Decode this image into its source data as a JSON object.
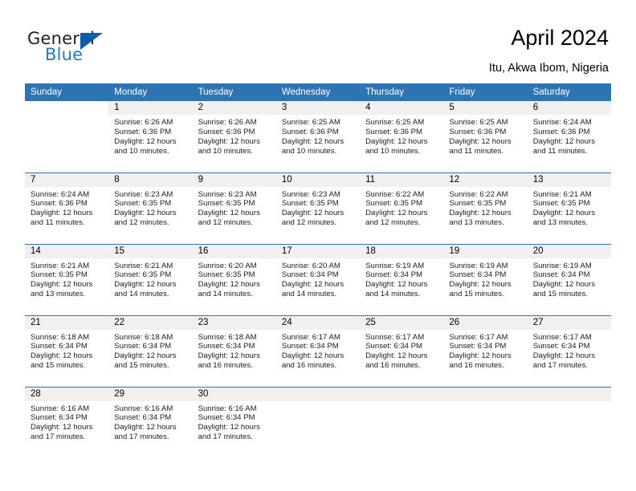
{
  "brand": {
    "name_part1": "General",
    "name_part2": "Blue",
    "triangle_icon": "triangle-icon"
  },
  "header": {
    "title": "April 2024",
    "location": "Itu, Akwa Ibom, Nigeria"
  },
  "colors": {
    "header_blue": "#2d74b5",
    "daynum_band": "#f0f0f0",
    "brand_blue": "#1f7ac4",
    "triangle_blue": "#0b5ea8"
  },
  "calendar": {
    "weekday_headers": [
      "Sunday",
      "Monday",
      "Tuesday",
      "Wednesday",
      "Thursday",
      "Friday",
      "Saturday"
    ],
    "weeks": [
      [
        {
          "day": "",
          "blank": true,
          "sunrise": "",
          "sunset": "",
          "daylight1": "",
          "daylight2": ""
        },
        {
          "day": "1",
          "sunrise": "Sunrise: 6:26 AM",
          "sunset": "Sunset: 6:36 PM",
          "daylight1": "Daylight: 12 hours",
          "daylight2": "and 10 minutes."
        },
        {
          "day": "2",
          "sunrise": "Sunrise: 6:26 AM",
          "sunset": "Sunset: 6:36 PM",
          "daylight1": "Daylight: 12 hours",
          "daylight2": "and 10 minutes."
        },
        {
          "day": "3",
          "sunrise": "Sunrise: 6:25 AM",
          "sunset": "Sunset: 6:36 PM",
          "daylight1": "Daylight: 12 hours",
          "daylight2": "and 10 minutes."
        },
        {
          "day": "4",
          "sunrise": "Sunrise: 6:25 AM",
          "sunset": "Sunset: 6:36 PM",
          "daylight1": "Daylight: 12 hours",
          "daylight2": "and 10 minutes."
        },
        {
          "day": "5",
          "sunrise": "Sunrise: 6:25 AM",
          "sunset": "Sunset: 6:36 PM",
          "daylight1": "Daylight: 12 hours",
          "daylight2": "and 11 minutes."
        },
        {
          "day": "6",
          "sunrise": "Sunrise: 6:24 AM",
          "sunset": "Sunset: 6:36 PM",
          "daylight1": "Daylight: 12 hours",
          "daylight2": "and 11 minutes."
        }
      ],
      [
        {
          "day": "7",
          "sunrise": "Sunrise: 6:24 AM",
          "sunset": "Sunset: 6:36 PM",
          "daylight1": "Daylight: 12 hours",
          "daylight2": "and 11 minutes."
        },
        {
          "day": "8",
          "sunrise": "Sunrise: 6:23 AM",
          "sunset": "Sunset: 6:35 PM",
          "daylight1": "Daylight: 12 hours",
          "daylight2": "and 12 minutes."
        },
        {
          "day": "9",
          "sunrise": "Sunrise: 6:23 AM",
          "sunset": "Sunset: 6:35 PM",
          "daylight1": "Daylight: 12 hours",
          "daylight2": "and 12 minutes."
        },
        {
          "day": "10",
          "sunrise": "Sunrise: 6:23 AM",
          "sunset": "Sunset: 6:35 PM",
          "daylight1": "Daylight: 12 hours",
          "daylight2": "and 12 minutes."
        },
        {
          "day": "11",
          "sunrise": "Sunrise: 6:22 AM",
          "sunset": "Sunset: 6:35 PM",
          "daylight1": "Daylight: 12 hours",
          "daylight2": "and 12 minutes."
        },
        {
          "day": "12",
          "sunrise": "Sunrise: 6:22 AM",
          "sunset": "Sunset: 6:35 PM",
          "daylight1": "Daylight: 12 hours",
          "daylight2": "and 13 minutes."
        },
        {
          "day": "13",
          "sunrise": "Sunrise: 6:21 AM",
          "sunset": "Sunset: 6:35 PM",
          "daylight1": "Daylight: 12 hours",
          "daylight2": "and 13 minutes."
        }
      ],
      [
        {
          "day": "14",
          "sunrise": "Sunrise: 6:21 AM",
          "sunset": "Sunset: 6:35 PM",
          "daylight1": "Daylight: 12 hours",
          "daylight2": "and 13 minutes."
        },
        {
          "day": "15",
          "sunrise": "Sunrise: 6:21 AM",
          "sunset": "Sunset: 6:35 PM",
          "daylight1": "Daylight: 12 hours",
          "daylight2": "and 14 minutes."
        },
        {
          "day": "16",
          "sunrise": "Sunrise: 6:20 AM",
          "sunset": "Sunset: 6:35 PM",
          "daylight1": "Daylight: 12 hours",
          "daylight2": "and 14 minutes."
        },
        {
          "day": "17",
          "sunrise": "Sunrise: 6:20 AM",
          "sunset": "Sunset: 6:34 PM",
          "daylight1": "Daylight: 12 hours",
          "daylight2": "and 14 minutes."
        },
        {
          "day": "18",
          "sunrise": "Sunrise: 6:19 AM",
          "sunset": "Sunset: 6:34 PM",
          "daylight1": "Daylight: 12 hours",
          "daylight2": "and 14 minutes."
        },
        {
          "day": "19",
          "sunrise": "Sunrise: 6:19 AM",
          "sunset": "Sunset: 6:34 PM",
          "daylight1": "Daylight: 12 hours",
          "daylight2": "and 15 minutes."
        },
        {
          "day": "20",
          "sunrise": "Sunrise: 6:19 AM",
          "sunset": "Sunset: 6:34 PM",
          "daylight1": "Daylight: 12 hours",
          "daylight2": "and 15 minutes."
        }
      ],
      [
        {
          "day": "21",
          "sunrise": "Sunrise: 6:18 AM",
          "sunset": "Sunset: 6:34 PM",
          "daylight1": "Daylight: 12 hours",
          "daylight2": "and 15 minutes."
        },
        {
          "day": "22",
          "sunrise": "Sunrise: 6:18 AM",
          "sunset": "Sunset: 6:34 PM",
          "daylight1": "Daylight: 12 hours",
          "daylight2": "and 15 minutes."
        },
        {
          "day": "23",
          "sunrise": "Sunrise: 6:18 AM",
          "sunset": "Sunset: 6:34 PM",
          "daylight1": "Daylight: 12 hours",
          "daylight2": "and 16 minutes."
        },
        {
          "day": "24",
          "sunrise": "Sunrise: 6:17 AM",
          "sunset": "Sunset: 6:34 PM",
          "daylight1": "Daylight: 12 hours",
          "daylight2": "and 16 minutes."
        },
        {
          "day": "25",
          "sunrise": "Sunrise: 6:17 AM",
          "sunset": "Sunset: 6:34 PM",
          "daylight1": "Daylight: 12 hours",
          "daylight2": "and 16 minutes."
        },
        {
          "day": "26",
          "sunrise": "Sunrise: 6:17 AM",
          "sunset": "Sunset: 6:34 PM",
          "daylight1": "Daylight: 12 hours",
          "daylight2": "and 16 minutes."
        },
        {
          "day": "27",
          "sunrise": "Sunrise: 6:17 AM",
          "sunset": "Sunset: 6:34 PM",
          "daylight1": "Daylight: 12 hours",
          "daylight2": "and 17 minutes."
        }
      ],
      [
        {
          "day": "28",
          "sunrise": "Sunrise: 6:16 AM",
          "sunset": "Sunset: 6:34 PM",
          "daylight1": "Daylight: 12 hours",
          "daylight2": "and 17 minutes."
        },
        {
          "day": "29",
          "sunrise": "Sunrise: 6:16 AM",
          "sunset": "Sunset: 6:34 PM",
          "daylight1": "Daylight: 12 hours",
          "daylight2": "and 17 minutes."
        },
        {
          "day": "30",
          "sunrise": "Sunrise: 6:16 AM",
          "sunset": "Sunset: 6:34 PM",
          "daylight1": "Daylight: 12 hours",
          "daylight2": "and 17 minutes."
        },
        {
          "day": "",
          "empty": true,
          "sunrise": "",
          "sunset": "",
          "daylight1": "",
          "daylight2": ""
        },
        {
          "day": "",
          "empty": true,
          "sunrise": "",
          "sunset": "",
          "daylight1": "",
          "daylight2": ""
        },
        {
          "day": "",
          "empty": true,
          "sunrise": "",
          "sunset": "",
          "daylight1": "",
          "daylight2": ""
        },
        {
          "day": "",
          "empty": true,
          "sunrise": "",
          "sunset": "",
          "daylight1": "",
          "daylight2": ""
        }
      ]
    ]
  }
}
